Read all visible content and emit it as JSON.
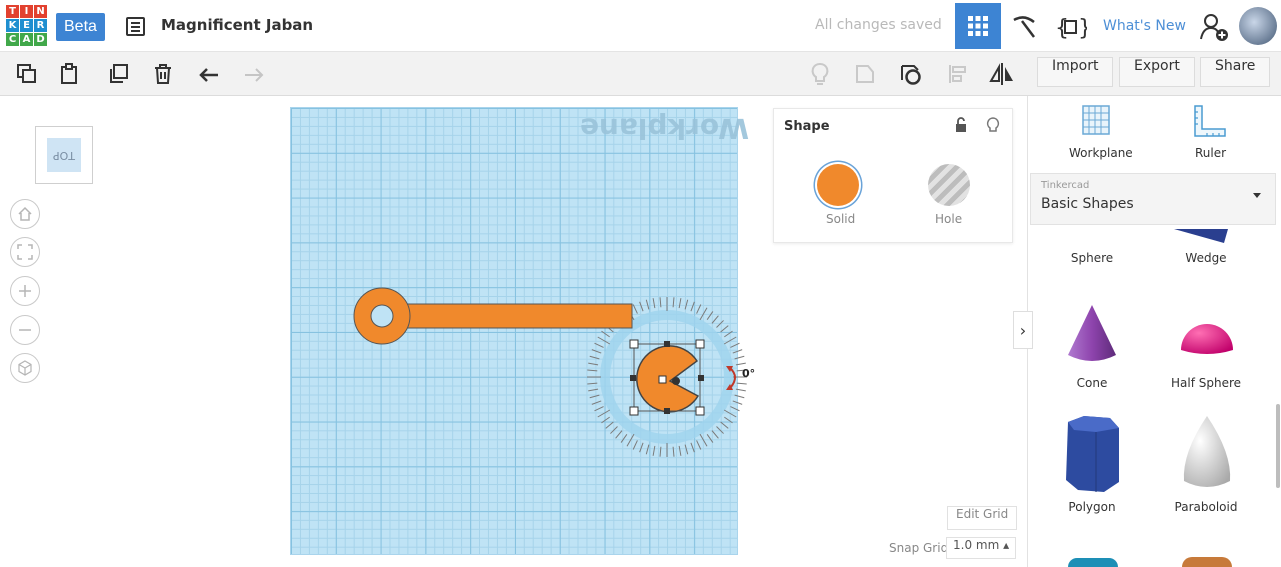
{
  "app": {
    "logo_letters": [
      "T",
      "I",
      "N",
      "K",
      "E",
      "R",
      "C",
      "A",
      "D"
    ],
    "logo_colors": [
      "#e2412f",
      "#e2412f",
      "#e2412f",
      "#1f8fd0",
      "#1f8fd0",
      "#1f8fd0",
      "#41a84a",
      "#41a84a",
      "#41a84a"
    ],
    "beta_label": "Beta",
    "project_name": "Magnificent Jaban",
    "save_status": "All changes saved",
    "whats_new": "What's New"
  },
  "toolbar": {
    "import_label": "Import",
    "export_label": "Export",
    "share_label": "Share"
  },
  "viewcube": {
    "face_label": "TOP"
  },
  "workplane": {
    "label": "Workplane"
  },
  "rotation": {
    "angle_label": "0°"
  },
  "shape_panel": {
    "title": "Shape",
    "solid_label": "Solid",
    "hole_label": "Hole",
    "solid_color": "#f0892c"
  },
  "right_panel": {
    "workplane_label": "Workplane",
    "ruler_label": "Ruler",
    "library_source": "Tinkercad",
    "library_value": "Basic Shapes",
    "shapes": [
      {
        "name": "Sphere",
        "icon": "sphere-icon"
      },
      {
        "name": "Wedge",
        "icon": "wedge-icon"
      },
      {
        "name": "Cone",
        "icon": "cone-icon"
      },
      {
        "name": "Half Sphere",
        "icon": "half-sphere-icon"
      },
      {
        "name": "Polygon",
        "icon": "polygon-icon"
      },
      {
        "name": "Paraboloid",
        "icon": "paraboloid-icon"
      }
    ]
  },
  "grid": {
    "edit_grid_label": "Edit Grid",
    "snap_grid_label": "Snap Grid",
    "snap_grid_value": "1.0 mm ▴"
  },
  "colors": {
    "accent": "#3d84d3",
    "shape_orange": "#f0892c",
    "workplane_blue": "#bfe3f5"
  }
}
